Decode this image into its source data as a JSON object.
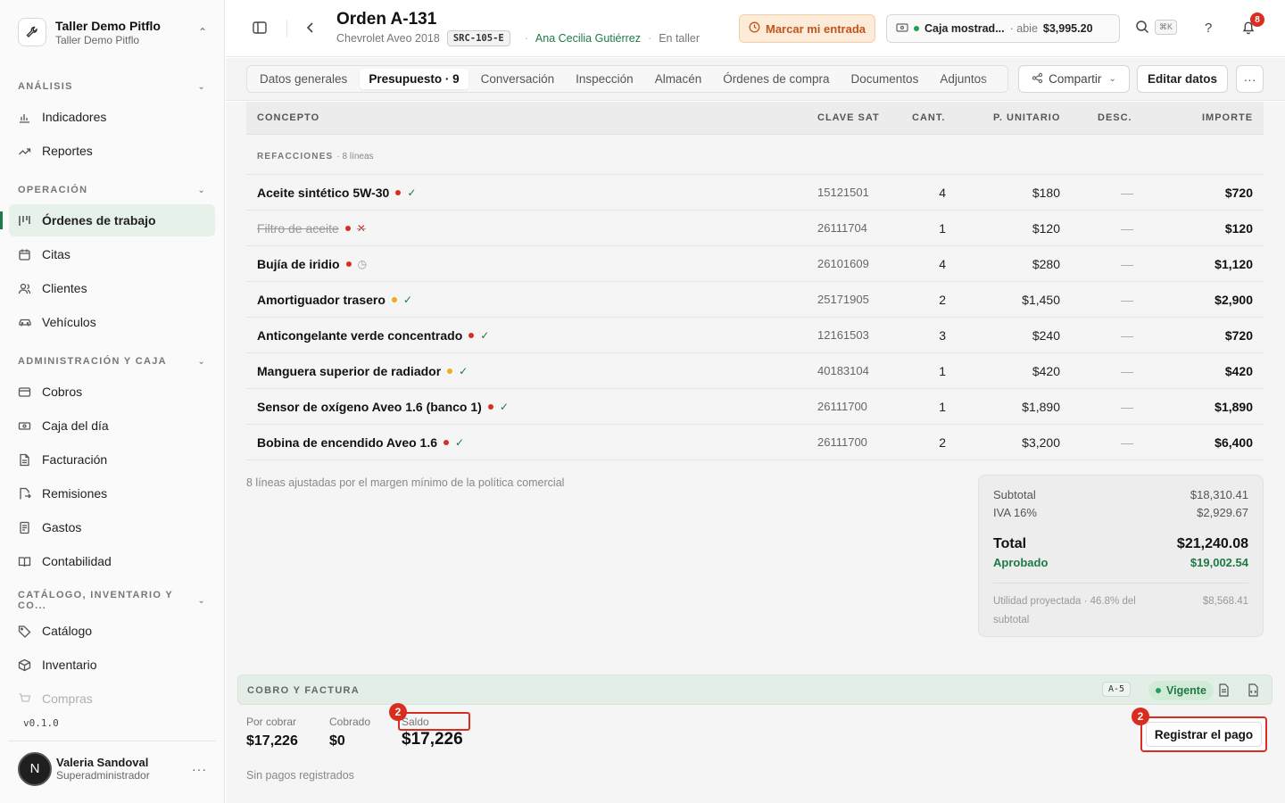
{
  "org": {
    "name": "Taller Demo Pitflo",
    "sub": "Taller Demo Pitflo"
  },
  "sidebar": {
    "sections": [
      {
        "label": "ANÁLISIS"
      },
      {
        "label": "OPERACIÓN"
      },
      {
        "label": "ADMINISTRACIÓN Y CAJA"
      },
      {
        "label": "CATÁLOGO, INVENTARIO Y CO..."
      }
    ],
    "items": [
      {
        "label": "Indicadores",
        "icon": "bar-chart-icon"
      },
      {
        "label": "Reportes",
        "icon": "trend-icon"
      },
      {
        "label": "Órdenes de trabajo",
        "icon": "kanban-icon",
        "active": true
      },
      {
        "label": "Citas",
        "icon": "calendar-icon"
      },
      {
        "label": "Clientes",
        "icon": "users-icon"
      },
      {
        "label": "Vehículos",
        "icon": "car-icon"
      },
      {
        "label": "Cobros",
        "icon": "card-icon"
      },
      {
        "label": "Caja del día",
        "icon": "cash-icon"
      },
      {
        "label": "Facturación",
        "icon": "file-icon"
      },
      {
        "label": "Remisiones",
        "icon": "file-arrow-icon"
      },
      {
        "label": "Gastos",
        "icon": "receipt-icon"
      },
      {
        "label": "Contabilidad",
        "icon": "book-icon"
      },
      {
        "label": "Catálogo",
        "icon": "tag-icon"
      },
      {
        "label": "Inventario",
        "icon": "box-icon"
      },
      {
        "label": "Compras",
        "icon": "cart-icon"
      }
    ],
    "version": "v0.1.0",
    "user": {
      "initial": "N",
      "name": "Valeria Sandoval",
      "role": "Superadministrador"
    }
  },
  "header": {
    "title": "Orden A-131",
    "vehicle": "Chevrolet Aveo 2018",
    "plate": "SRC-105-E",
    "customer": "Ana Cecilia Gutiérrez",
    "status": "En taller",
    "entry_button": "Marcar mi entrada",
    "caja": {
      "name": "Caja mostrad...",
      "status": "abie",
      "amount": "$3,995.20"
    },
    "shortcut": "⌘K",
    "notif_count": "8"
  },
  "tabs": [
    {
      "label": "Datos generales"
    },
    {
      "label": "Presupuesto · 9",
      "active": true
    },
    {
      "label": "Conversación"
    },
    {
      "label": "Inspección"
    },
    {
      "label": "Almacén"
    },
    {
      "label": "Órdenes de compra"
    },
    {
      "label": "Documentos"
    },
    {
      "label": "Adjuntos"
    }
  ],
  "actions": {
    "share": "Compartir",
    "edit": "Editar datos"
  },
  "table": {
    "headers": {
      "concept": "CONCEPTO",
      "sat": "CLAVE SAT",
      "qty": "CANT.",
      "unit": "P. UNITARIO",
      "desc": "DESC.",
      "amount": "IMPORTE"
    },
    "group": {
      "label": "REFACCIONES",
      "count": "· 8 líneas"
    },
    "rows": [
      {
        "name": "Aceite sintético 5W-30",
        "dot": "#d92d20",
        "status": "check",
        "sat": "15121501",
        "qty": "4",
        "unit": "$180",
        "desc": "—",
        "amount": "$720"
      },
      {
        "name": "Filtro de aceite",
        "dot": "#d92d20",
        "status": "cross",
        "struck": true,
        "sat": "26111704",
        "qty": "1",
        "unit": "$120",
        "desc": "—",
        "amount": "$120"
      },
      {
        "name": "Bujía de iridio",
        "dot": "#d92d20",
        "status": "clock",
        "sat": "26101609",
        "qty": "4",
        "unit": "$280",
        "desc": "—",
        "amount": "$1,120"
      },
      {
        "name": "Amortiguador trasero",
        "dot": "#f2a91c",
        "status": "check",
        "sat": "25171905",
        "qty": "2",
        "unit": "$1,450",
        "desc": "—",
        "amount": "$2,900"
      },
      {
        "name": "Anticongelante verde concentrado",
        "dot": "#d92d20",
        "status": "check",
        "sat": "12161503",
        "qty": "3",
        "unit": "$240",
        "desc": "—",
        "amount": "$720"
      },
      {
        "name": "Manguera superior de radiador",
        "dot": "#f2a91c",
        "status": "check",
        "sat": "40183104",
        "qty": "1",
        "unit": "$420",
        "desc": "—",
        "amount": "$420"
      },
      {
        "name": "Sensor de oxígeno Aveo 1.6 (banco 1)",
        "dot": "#d92d20",
        "status": "check",
        "sat": "26111700",
        "qty": "1",
        "unit": "$1,890",
        "desc": "—",
        "amount": "$1,890"
      },
      {
        "name": "Bobina de encendido Aveo 1.6",
        "dot": "#d92d20",
        "status": "check",
        "sat": "26111700",
        "qty": "2",
        "unit": "$3,200",
        "desc": "—",
        "amount": "$6,400"
      }
    ],
    "note": "8 líneas ajustadas por el margen mínimo de la política comercial"
  },
  "totals": {
    "subtotal_label": "Subtotal",
    "subtotal": "$18,310.41",
    "iva_label": "IVA 16%",
    "iva": "$2,929.67",
    "total_label": "Total",
    "total": "$21,240.08",
    "approved_label": "Aprobado",
    "approved": "$19,002.54",
    "util_label": "Utilidad proyectada · 46.8% del subtotal",
    "util": "$8,568.41"
  },
  "cobro": {
    "title": "COBRO Y FACTURA",
    "code": "A-5",
    "status": "Vigente",
    "por_cobrar_label": "Por cobrar",
    "por_cobrar": "$17,226",
    "cobrado_label": "Cobrado",
    "cobrado": "$0",
    "saldo_label": "Saldo",
    "saldo": "$17,226",
    "pay_button": "Registrar el pago",
    "no_payments": "Sin pagos registrados",
    "step": "2"
  },
  "colors": {
    "accent": "#1e7a45",
    "danger": "#d92d20",
    "warning": "#f2a91c"
  }
}
